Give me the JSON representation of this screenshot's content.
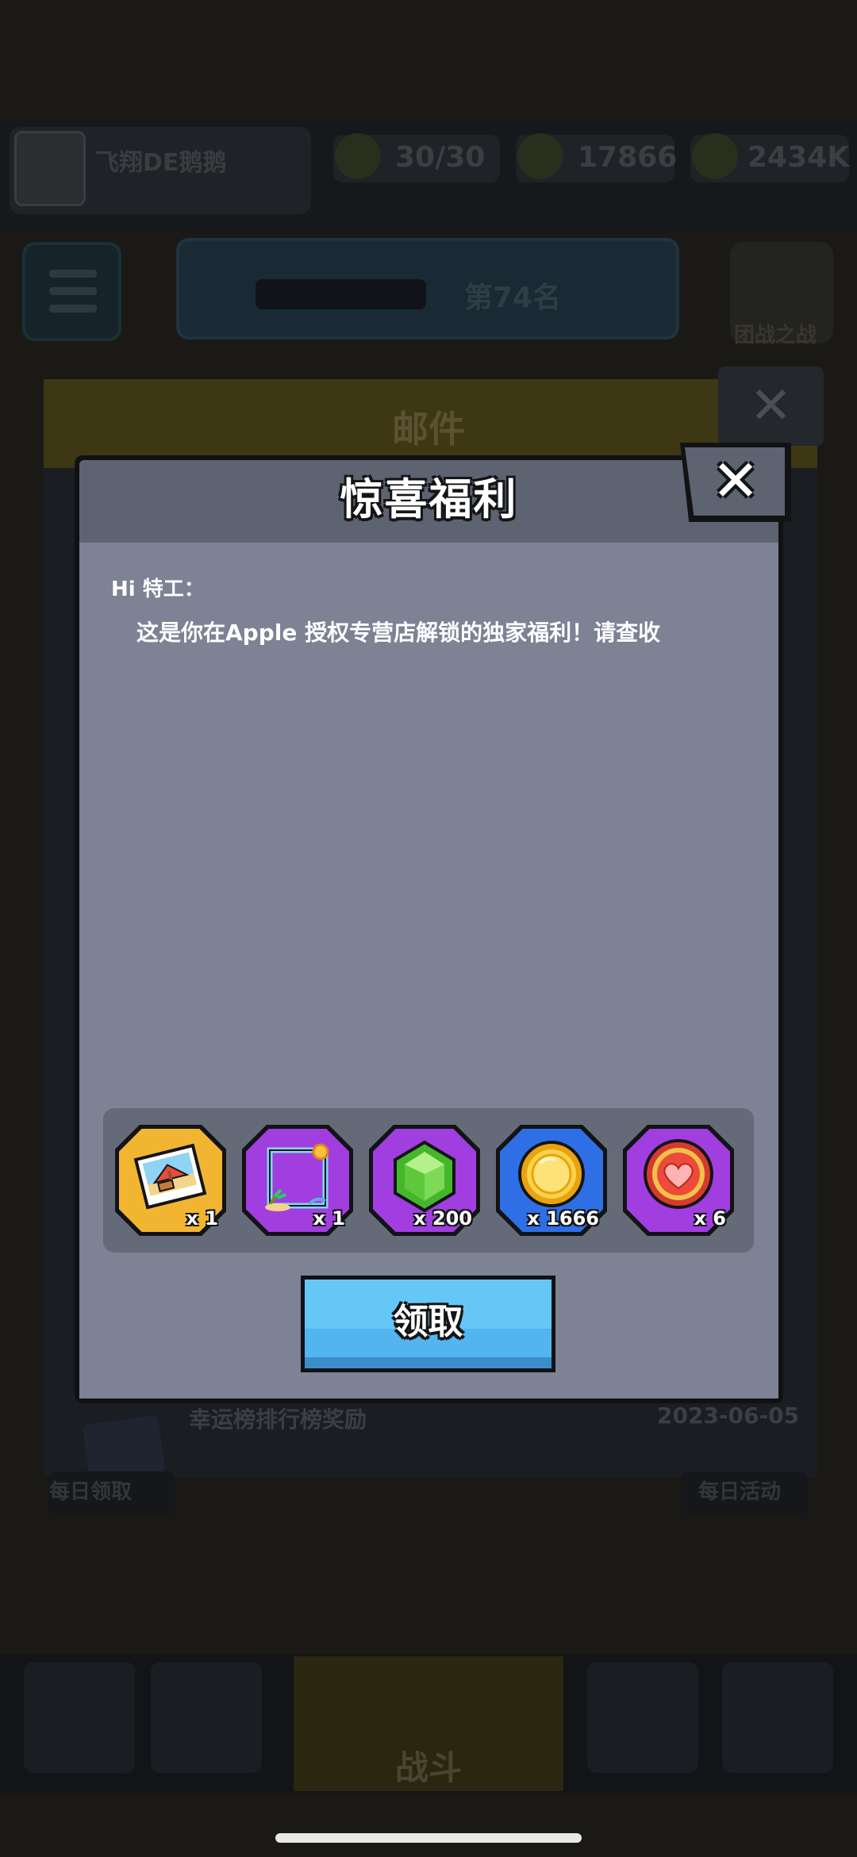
{
  "background": {
    "player_name": "飞翔DE鹅鹅",
    "resources": [
      "30/30",
      "17866",
      "2434K"
    ],
    "rank_label": "第74名",
    "shield_label": "团战之战",
    "mail_panel_title": "邮件",
    "mail_item": {
      "title": "幸运榜排行榜奖励",
      "date": "2023-06-05"
    },
    "side_tabs": [
      "每日领取",
      "每日活动"
    ],
    "battle_label": "战斗"
  },
  "dialog": {
    "title": "惊喜福利",
    "close_icon": "close-x-icon",
    "greeting": "Hi 特工：",
    "message": "这是你在Apple 授权专营店解锁的独家福利！请查收",
    "rewards": [
      {
        "icon": "beach-photo-icon",
        "qty": "x 1",
        "frame": "gold"
      },
      {
        "icon": "beach-frame-icon",
        "qty": "x 1",
        "frame": "purple"
      },
      {
        "icon": "green-gem-icon",
        "qty": "x 200",
        "frame": "purple"
      },
      {
        "icon": "gold-coin-icon",
        "qty": "x 1666",
        "frame": "blue"
      },
      {
        "icon": "red-heart-icon",
        "qty": "x 6",
        "frame": "purple"
      }
    ],
    "claim_label": "领取"
  },
  "colors": {
    "header": "#5e6371",
    "body": "#7d8294",
    "tray": "#656a79",
    "claim_button": "#52b5ef",
    "frame_gold": "#f2b531",
    "frame_purple": "#a13ee0",
    "frame_blue": "#2f6fe6"
  }
}
